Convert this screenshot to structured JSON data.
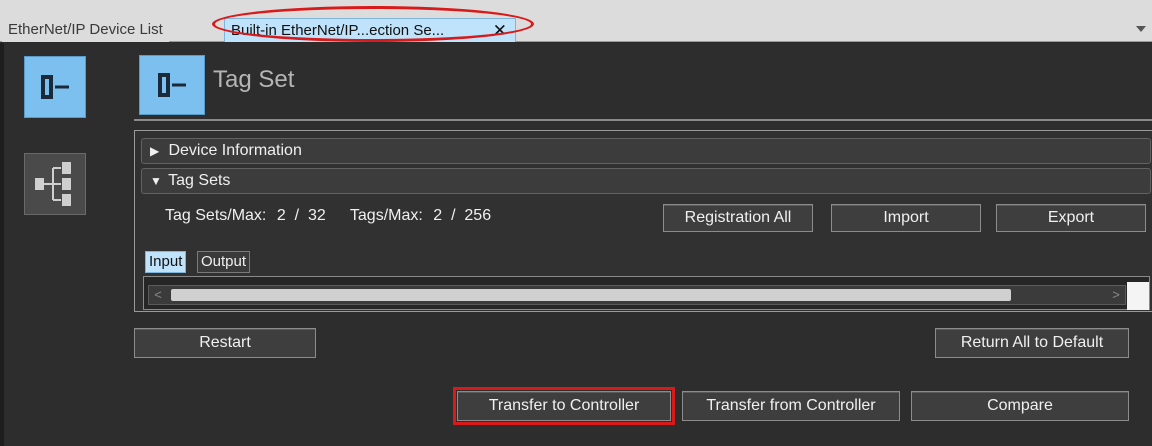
{
  "tabs": {
    "device_list": "EtherNet/IP Device List",
    "active": "Built-in EtherNet/IP...ection Se...",
    "close_glyph": "✕"
  },
  "header": {
    "title": "Tag Set"
  },
  "sections": {
    "device_info": "Device Information",
    "tag_sets": "Tag Sets",
    "collapsed_arrow": "▶",
    "expanded_arrow": "▼"
  },
  "counts": {
    "tag_sets_label": "Tag Sets/Max:",
    "tag_sets_value": "2  /  32",
    "tags_label": "Tags/Max:",
    "tags_value": "2  /  256"
  },
  "buttons": {
    "registration_all": "Registration All",
    "import": "Import",
    "export": "Export",
    "restart": "Restart",
    "return_all_default": "Return All to Default",
    "transfer_to_controller": "Transfer to Controller",
    "transfer_from_controller": "Transfer from Controller",
    "compare": "Compare"
  },
  "subtabs": {
    "input": "Input",
    "output": "Output"
  },
  "scrollbar": {
    "left_glyph": "<",
    "right_glyph": ">"
  },
  "colors": {
    "accent_tab": "#bfe3fb",
    "highlight_red": "#d91a1a",
    "icon_blue": "#7cc0ef"
  },
  "icons": {
    "tagset": "tag-set-icon",
    "tree": "connection-tree-icon"
  }
}
